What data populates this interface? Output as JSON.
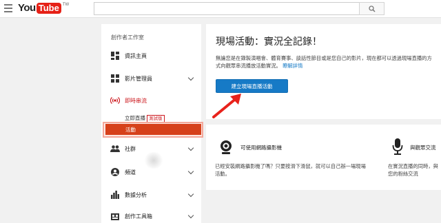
{
  "header": {
    "logo_you": "You",
    "logo_tube": "Tube",
    "logo_region": "TW",
    "search_placeholder": ""
  },
  "sidebar": {
    "title": "創作者工作室",
    "items": [
      {
        "label": "資訊主頁",
        "icon": "dashboard-icon"
      },
      {
        "label": "影片管理員",
        "icon": "video-manager-icon"
      },
      {
        "label": "即時串流",
        "icon": "live-broadcast-icon"
      },
      {
        "label": "社群",
        "icon": "community-icon"
      },
      {
        "label": "頻道",
        "icon": "channel-icon"
      },
      {
        "label": "數據分析",
        "icon": "analytics-icon"
      },
      {
        "label": "創作工具箱",
        "icon": "create-toolbox-icon"
      }
    ],
    "live_sub": {
      "stream_now": "立即直播",
      "beta_badge": "測試版",
      "events": "活動"
    }
  },
  "main": {
    "title": "現場活動：實況全記錄！",
    "description_1": "無論您是在錄製演唱會、體育賽事、談話性節目或是您自己的影片，現在都可以透過現場直播的方式向觀眾串流播放活動實況。",
    "learn_more": "瞭解詳情",
    "create_button": "建立現場直播活動"
  },
  "features": [
    {
      "title": "可使用網路攝影機",
      "desc": "已經安裝網路攝影機了嗎？只要按滑下滑鼠，就可以自己辦一場現場活動。",
      "icon": "webcam-icon"
    },
    {
      "title": "與觀眾交流",
      "desc": "在實況直播的同時，與您的粉絲交流",
      "icon": "microphone-icon"
    }
  ],
  "colors": {
    "accent": "#167ac6",
    "brand_red": "#e62117",
    "highlight": "#d6401a",
    "arrow": "#e8221b"
  }
}
